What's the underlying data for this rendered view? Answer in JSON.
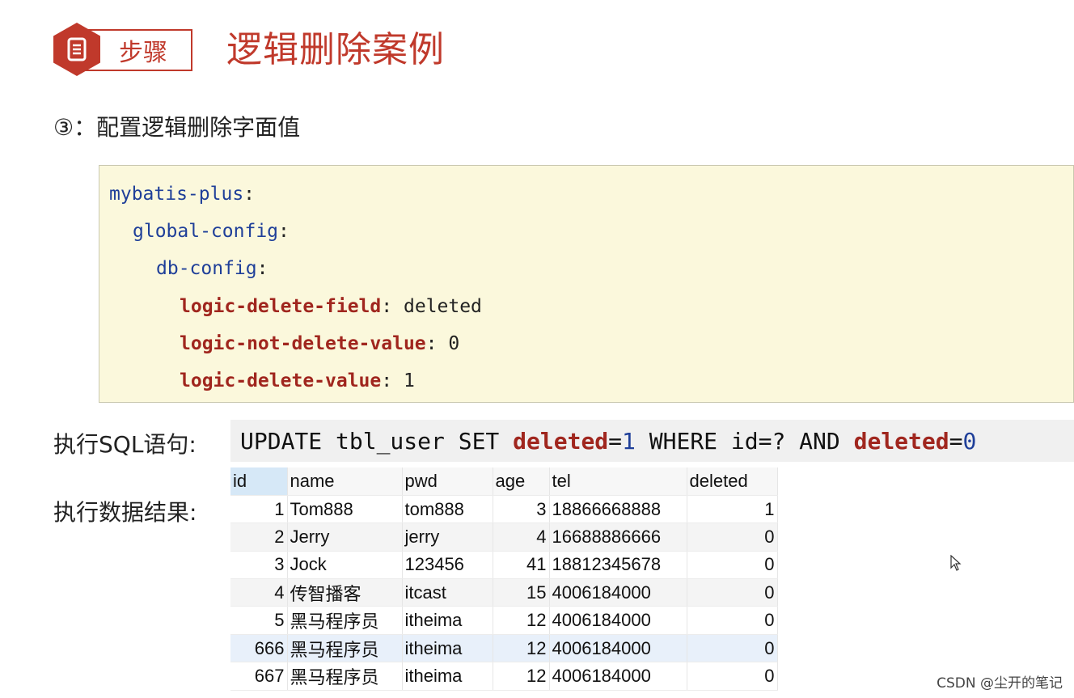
{
  "header": {
    "badge_label": "步骤",
    "title": "逻辑删除案例",
    "accent_color": "#c0392b",
    "badge_icon": "document-icon"
  },
  "subtitle": "③：配置逻辑删除字面值",
  "code": {
    "line1_key": "mybatis-plus",
    "line2_key": "global-config",
    "line3_key": "db-config",
    "line4_key": "logic-delete-field",
    "line4_value": "deleted",
    "line5_key": "logic-not-delete-value",
    "line5_value": "0",
    "line6_key": "logic-delete-value",
    "line6_value": "1",
    "colon": ":"
  },
  "sql": {
    "label": "执行SQL语句:",
    "p1": "UPDATE tbl_user SET ",
    "p2": "deleted",
    "p3": "=",
    "p4": "1",
    "p5": " WHERE id=? AND ",
    "p6": "deleted",
    "p7": "=",
    "p8": "0"
  },
  "result": {
    "label": "执行数据结果:",
    "columns": [
      "id",
      "name",
      "pwd",
      "age",
      "tel",
      "deleted"
    ],
    "rows": [
      [
        "1",
        "Tom888",
        "tom888",
        "3",
        "18866668888",
        "1"
      ],
      [
        "2",
        "Jerry",
        "jerry",
        "4",
        "16688886666",
        "0"
      ],
      [
        "3",
        "Jock",
        "123456",
        "41",
        "18812345678",
        "0"
      ],
      [
        "4",
        "传智播客",
        "itcast",
        "15",
        "4006184000",
        "0"
      ],
      [
        "5",
        "黑马程序员",
        "itheima",
        "12",
        "4006184000",
        "0"
      ],
      [
        "666",
        "黑马程序员",
        "itheima",
        "12",
        "4006184000",
        "0"
      ],
      [
        "667",
        "黑马程序员",
        "itheima",
        "12",
        "4006184000",
        "0"
      ]
    ]
  },
  "watermark": "CSDN @尘开的笔记"
}
